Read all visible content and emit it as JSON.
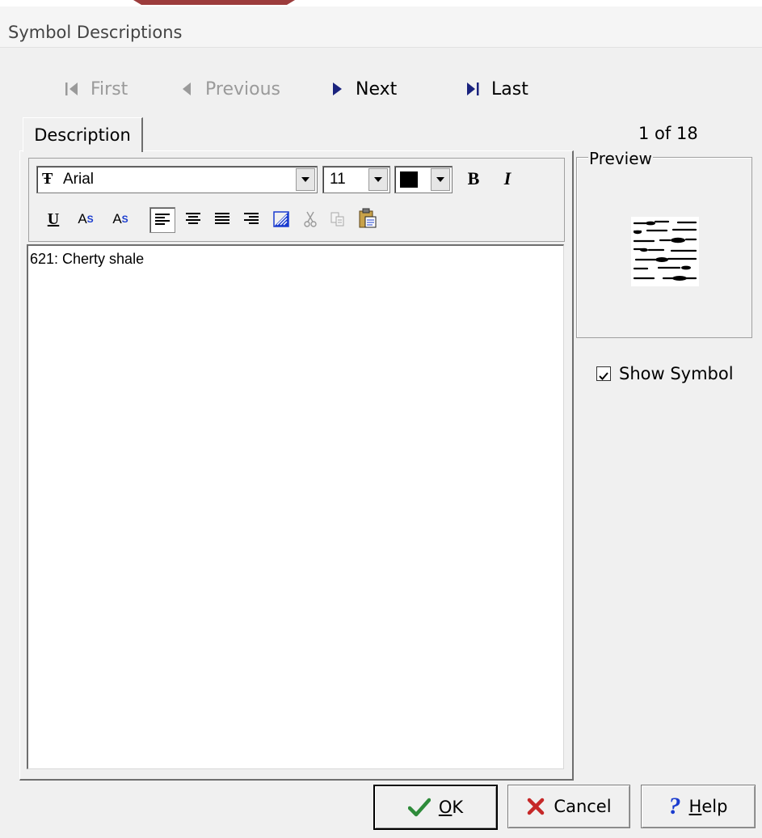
{
  "window": {
    "title": "Symbol Descriptions"
  },
  "nav": {
    "first": {
      "label": "First",
      "enabled": false,
      "icon": "first-record-icon"
    },
    "previous": {
      "label": "Previous",
      "enabled": false,
      "icon": "previous-record-icon"
    },
    "next": {
      "label": "Next",
      "enabled": true,
      "icon": "next-record-icon"
    },
    "last": {
      "label": "Last",
      "enabled": true,
      "icon": "last-record-icon"
    }
  },
  "tabs": [
    {
      "label": "Description",
      "active": true
    }
  ],
  "toolbar": {
    "font": "Arial",
    "size": "11",
    "color": "#000000",
    "bold_label": "B",
    "italic_label": "I",
    "underline_label": "U",
    "superscript_label": "A",
    "superscript_mark": "S",
    "subscript_label": "A",
    "subscript_mark": "S",
    "alignment": "left"
  },
  "editor": {
    "text": "621: Cherty shale"
  },
  "record": {
    "counter": "1 of 18"
  },
  "preview": {
    "label": "Preview"
  },
  "show_symbol": {
    "label": "Show Symbol",
    "checked": true
  },
  "buttons": {
    "ok": "OK",
    "cancel": "Cancel",
    "help": "Help"
  },
  "colors": {
    "nav_icon": "#1a237e",
    "disabled": "#9a9a9a",
    "ok_check": "#2e8b3a",
    "cancel_x": "#c62828",
    "help_q": "#1a3ccf"
  }
}
